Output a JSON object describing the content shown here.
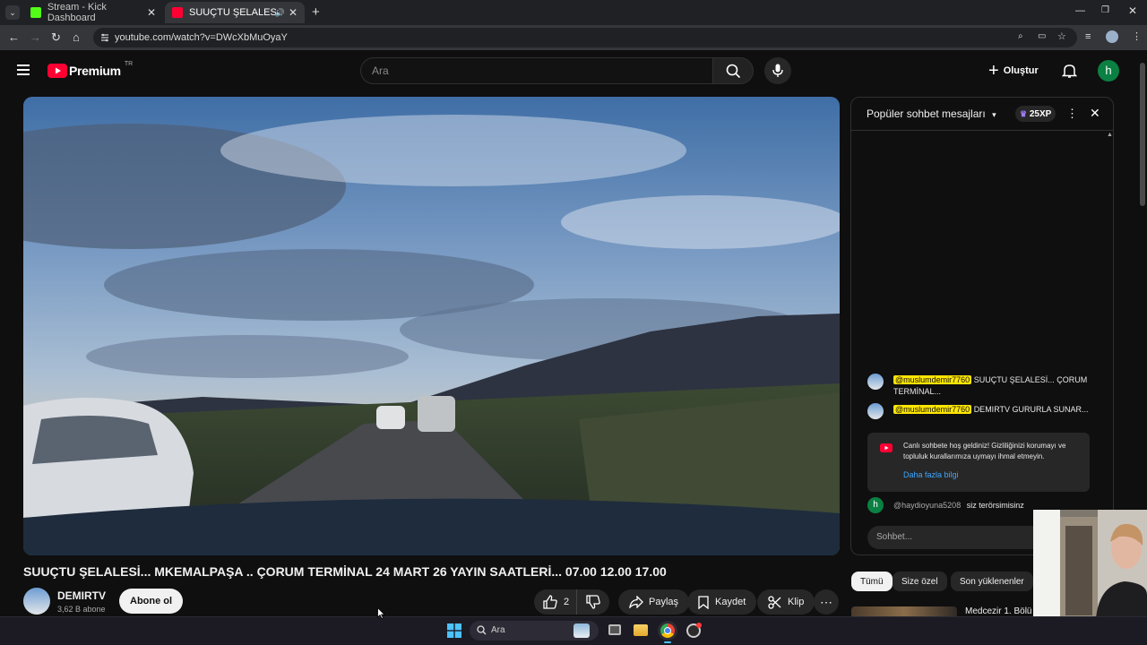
{
  "browser": {
    "tabs": [
      {
        "title": "Stream - Kick Dashboard",
        "favicon_color": "#53fc18"
      },
      {
        "title": "SUUÇTU ŞELALESİ... MKEMA",
        "favicon_color": "#ff0033"
      }
    ],
    "url": "youtube.com/watch?v=DWcXbMuOyaY"
  },
  "youtube": {
    "logo_text": "Premium",
    "logo_sup": "TR",
    "search_placeholder": "Ara",
    "create_label": "Oluştur",
    "avatar_letter": "h",
    "accent": "#ff0033"
  },
  "video": {
    "title": "SUUÇTU ŞELALESİ... MKEMALPAŞA .. ÇORUM TERMİNAL 24 MART 26 YAYIN SAATLERİ... 07.00 12.00 17.00",
    "channel_name": "DEMIRTV",
    "subscribers": "3,62 B abone",
    "subscribe_label": "Abone ol",
    "like_count": "2",
    "share_label": "Paylaş",
    "save_label": "Kaydet",
    "clip_label": "Klip"
  },
  "chat": {
    "header": "Popüler sohbet mesajları",
    "xp_badge": "25XP",
    "messages": [
      {
        "mention": "@muslumdemir7760",
        "text": "SUUÇTU ŞELALESİ... ÇORUM TERMİNAL..."
      },
      {
        "mention": "@muslumdemir7760",
        "text": "DEMIRTV GURURLA SUNAR..."
      }
    ],
    "welcome_text": "Canlı sohbete hoş geldiniz! Gizliliğinizi korumayı ve topluluk kurallarımıza uymayı ihmal etmeyin.",
    "welcome_link": "Daha fazla bilgi",
    "user_message": {
      "author": "@haydioyuna5208",
      "text": "siz terörsimisinz",
      "avatar_letter": "h"
    },
    "input_placeholder": "Sohbet..."
  },
  "recommendations": {
    "chips": [
      "Tümü",
      "Size özel",
      "Son yüklenenler"
    ],
    "first_title": "Medcezir 1. Bölü"
  },
  "taskbar": {
    "search_label": "Ara"
  }
}
